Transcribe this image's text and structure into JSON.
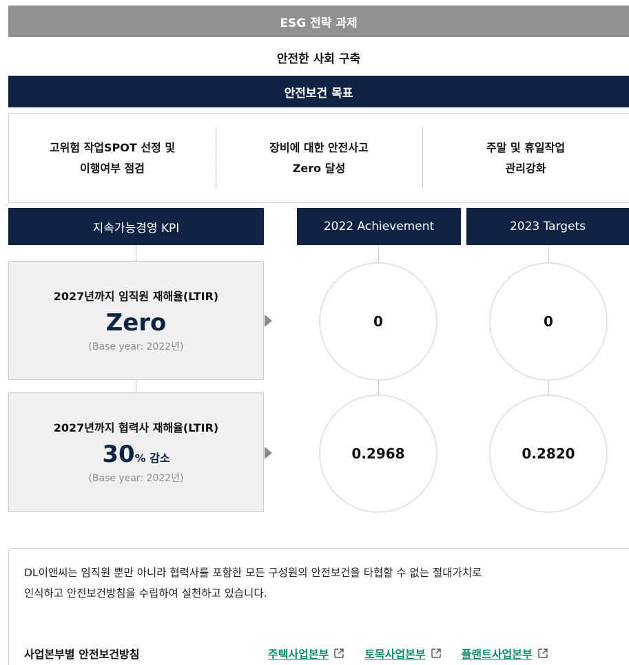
{
  "header": {
    "strategy_title": "ESG 전략 과제",
    "subtitle": "안전한 사회 구축",
    "goal_title": "안전보건 목표"
  },
  "goals": [
    {
      "line1": "고위험 작업SPOT 선정 및",
      "line2": "이행여부 점검"
    },
    {
      "line1": "장비에 대한 안전사고",
      "line2": "Zero 달성"
    },
    {
      "line1": "주말 및 휴일작업",
      "line2": "관리강화"
    }
  ],
  "table": {
    "col_kpi": "지속가능경영 KPI",
    "col_2022": "2022 Achievement",
    "col_2023": "2023 Targets",
    "rows": [
      {
        "title": "2027년까지 임직원 재해율(LTIR)",
        "big": "Zero",
        "suffix": "",
        "base": "(Base year: 2022년)",
        "achievement_2022": "0",
        "target_2023": "0"
      },
      {
        "title": "2027년까지 협력사 재해율(LTIR)",
        "big": "30",
        "suffix": "% 감소",
        "base": "(Base year: 2022년)",
        "achievement_2022": "0.2968",
        "target_2023": "0.2820"
      }
    ]
  },
  "note": {
    "line1": "DL이앤씨는 임직원 뿐만 아니라 협력사를 포함한 모든 구성원의 안전보건을 타협할 수 없는 절대가치로",
    "line2": "인식하고 안전보건방침을 수립하여 실천하고 있습니다.",
    "policy_label": "사업본부별 안전보건방침",
    "links": [
      {
        "label": "주택사업본부",
        "icon": "external-link-icon"
      },
      {
        "label": "토목사업본부",
        "icon": "external-link-icon"
      },
      {
        "label": "플랜트사업본부",
        "icon": "external-link-icon"
      }
    ]
  },
  "colors": {
    "navy": "#0f2344",
    "gray_bar": "#8f9193",
    "link_green": "#0a8a6b"
  }
}
